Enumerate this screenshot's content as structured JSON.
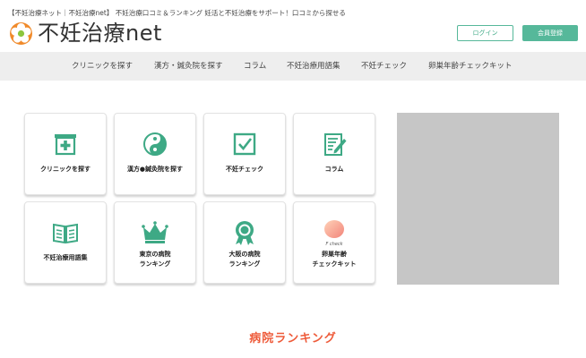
{
  "header": {
    "tagline": "【不妊治療ネット｜不妊治療net】 不妊治療口コミ＆ランキング 妊活と不妊治療をサポート！口コミから探せる",
    "logo_text": "不妊治療net",
    "login_label": "ログイン",
    "register_label": "会員登録"
  },
  "nav": {
    "items": [
      "クリニックを探す",
      "漢方・鍼灸院を探す",
      "コラム",
      "不妊治療用語集",
      "不妊チェック",
      "卵巣年齢チェックキット"
    ]
  },
  "cards": [
    {
      "label": "クリニックを探す",
      "icon": "clinic-icon"
    },
    {
      "label": "漢方●鍼灸院を探す",
      "icon": "yin-yang-icon"
    },
    {
      "label": "不妊チェック",
      "icon": "checkbox-icon"
    },
    {
      "label": "コラム",
      "icon": "note-pen-icon"
    },
    {
      "label": "不妊治療用語集",
      "icon": "book-icon"
    },
    {
      "label_line1": "東京の病院",
      "label_line2": "ランキング",
      "icon": "crown-icon"
    },
    {
      "label_line1": "大阪の病院",
      "label_line2": "ランキング",
      "icon": "medal-icon"
    },
    {
      "label_line1": "卵巣年齢",
      "label_line2": "チェックキット",
      "icon": "fcheck-icon",
      "icon_caption": "F check"
    }
  ],
  "section": {
    "ranking_title": "病院ランキング"
  },
  "colors": {
    "accent": "#56b89a",
    "ranking": "#ee5b3a",
    "logo_orange": "#f08a2a"
  }
}
